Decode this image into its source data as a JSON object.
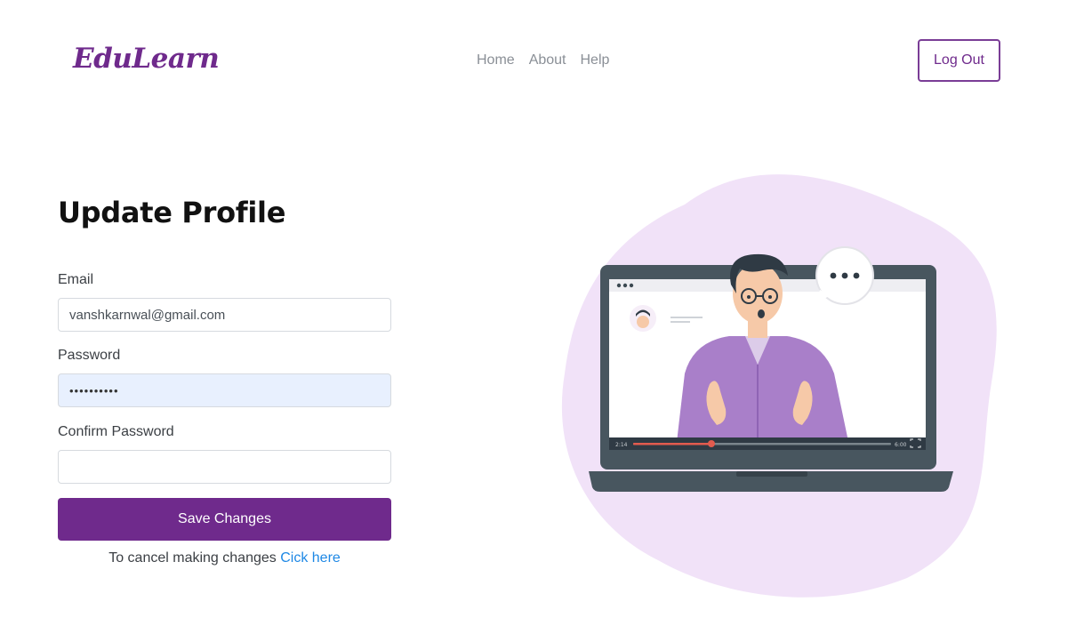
{
  "brand": {
    "name": "EduLearn"
  },
  "nav": {
    "links": [
      "Home",
      "About",
      "Help"
    ],
    "logout_label": "Log Out"
  },
  "form": {
    "title": "Update Profile",
    "email_label": "Email",
    "email_value": "vanshkarnwal@gmail.com",
    "password_label": "Password",
    "password_value": "••••••••••",
    "confirm_label": "Confirm Password",
    "confirm_value": "",
    "save_label": "Save Changes",
    "cancel_text": "To cancel making changes",
    "cancel_link": "Cick here"
  },
  "colors": {
    "brand": "#6f2a8c",
    "link": "#1e88e5",
    "blob": "#f1e2f8",
    "autofill": "#e8f0fe"
  },
  "illustration": {
    "icons": [
      "laptop-icon",
      "speech-bubble-icon",
      "video-progress-icon",
      "fullscreen-icon"
    ],
    "video_progress": 0.3
  }
}
